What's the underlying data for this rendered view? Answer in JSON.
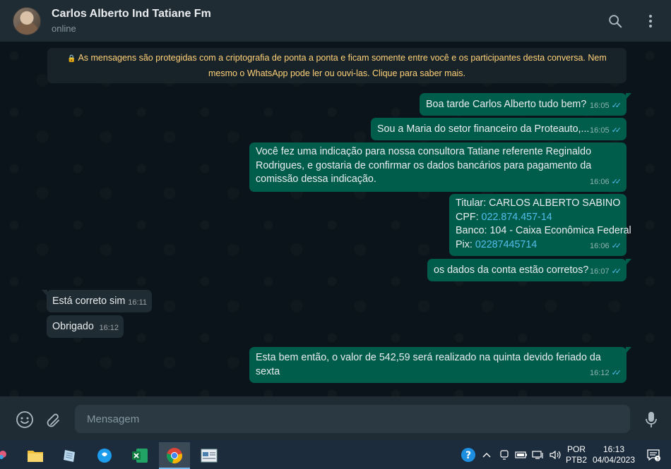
{
  "header": {
    "contact_name": "Carlos Alberto Ind Tatiane Fm",
    "status": "online",
    "icons": [
      "search-icon",
      "menu-icon"
    ]
  },
  "encryption_notice": "As mensagens são protegidas com a criptografia de ponta a ponta e ficam somente entre você e os participantes desta conversa. Nem mesmo o WhatsApp pode ler ou ouvi-las. Clique para saber mais.",
  "messages": [
    {
      "direction": "out",
      "text": "Boa tarde Carlos Alberto tudo bem?",
      "time": "16:05"
    },
    {
      "direction": "out",
      "text": "Sou a Maria do setor financeiro da Proteauto,...",
      "time": "16:05"
    },
    {
      "direction": "out",
      "text": "Você fez uma indicação para nossa consultora Tatiane referente Reginaldo Rodrigues, e gostaria de confirmar os dados bancários para pagamento da comissão dessa indicação.",
      "time": "16:06"
    },
    {
      "direction": "out",
      "lines": {
        "titular": "Titular: CARLOS ALBERTO SABINO",
        "cpf_label": "CPF: ",
        "cpf": "022.874.457-14",
        "banco": "Banco: 104 - Caixa Econômica Federal",
        "pix_label": "Pix: ",
        "pix": "02287445714"
      },
      "time": "16:06"
    },
    {
      "direction": "out",
      "text": "os dados da conta estão corretos?",
      "time": "16:07"
    },
    {
      "direction": "in",
      "text": "Está correto sim",
      "time": "16:11"
    },
    {
      "direction": "in",
      "text": "Obrigado",
      "time": "16:12"
    },
    {
      "direction": "out",
      "text": "Esta bem então, o valor de 542,59 será realizado na quinta devido feriado da sexta",
      "time": "16:12"
    }
  ],
  "composer": {
    "placeholder": "Mensagem",
    "icons": [
      "emoji-icon",
      "attach-icon",
      "microphone-icon"
    ]
  },
  "taskbar": {
    "apps": [
      "file-explorer",
      "notepad",
      "skype",
      "excel",
      "chrome",
      "app-window"
    ],
    "tray": {
      "lang_top": "POR",
      "lang_bottom": "PTB2",
      "time": "16:13",
      "date": "04/04/2023"
    }
  },
  "colors": {
    "outgoing_bubble": "#005c4b",
    "incoming_bubble": "#202c33",
    "ticks": "#53bdeb",
    "notice_text": "#ffd279"
  }
}
